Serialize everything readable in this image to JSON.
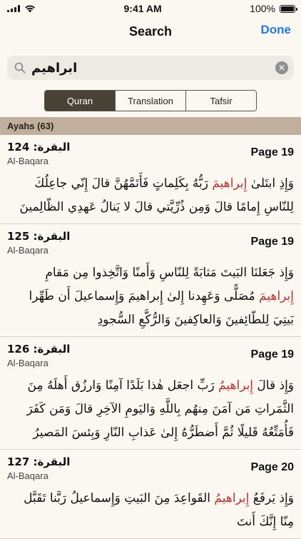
{
  "status": {
    "time": "9:41 AM",
    "battery": "100%"
  },
  "nav": {
    "title": "Search",
    "done_label": "Done"
  },
  "search": {
    "query": "ابراهيم"
  },
  "segments": [
    "Quran",
    "Translation",
    "Tafsir"
  ],
  "section": {
    "label": "Ayahs (63)"
  },
  "results": [
    {
      "surah_ar": "البقرة: 124",
      "surah_en": "Al-Baqara",
      "page": "Page 19",
      "pre": "وَإِذِ ابتَلىٰ ",
      "match": "إِبراهيمَ",
      "post": " رَبُّهُ بِكَلِماتٍ فَأَتَمَّهُنَّ قالَ إِنّي جاعِلُكَ لِلنّاسِ إِمامًا قالَ وَمِن ذُرِّيَّتي قالَ لا يَنالُ عَهدِي الظّالِمينَ"
    },
    {
      "surah_ar": "البقرة: 125",
      "surah_en": "Al-Baqara",
      "page": "Page 19",
      "pre": "وَإِذ جَعَلنَا البَيتَ مَثابَةً لِلنّاسِ وَأَمنًا وَاتَّخِذوا مِن مَقامِ ",
      "match": "إِبراهيمَ",
      "post": " مُصَلًّى وَعَهِدنا إِلىٰ إِبراهيمَ وَإِسماعيلَ أَن طَهِّرا بَيتِيَ لِلطّائِفينَ وَالعاكِفينَ وَالرُّكَّعِ السُّجودِ"
    },
    {
      "surah_ar": "البقرة: 126",
      "surah_en": "Al-Baqara",
      "page": "Page 19",
      "pre": "وَإِذ قالَ ",
      "match": "إِبراهيمُ",
      "post": " رَبِّ اجعَل هٰذا بَلَدًا آمِنًا وَارزُق أَهلَهُ مِنَ الثَّمَراتِ مَن آمَنَ مِنهُم بِاللَّهِ وَاليَومِ الآخِرِ قالَ وَمَن كَفَرَ فَأُمَتِّعُهُ قَليلًا ثُمَّ أَضطَرُّهُ إِلىٰ عَذابِ النّارِ وَبِئسَ المَصيرُ"
    },
    {
      "surah_ar": "البقرة: 127",
      "surah_en": "Al-Baqara",
      "page": "Page 20",
      "pre": "وَإِذ يَرفَعُ ",
      "match": "إِبراهيمُ",
      "post": " القَواعِدَ مِنَ البَيتِ وَإِسماعيلُ رَبَّنا تَقَبَّل مِنّا إِنَّكَ أَنتَ"
    }
  ]
}
